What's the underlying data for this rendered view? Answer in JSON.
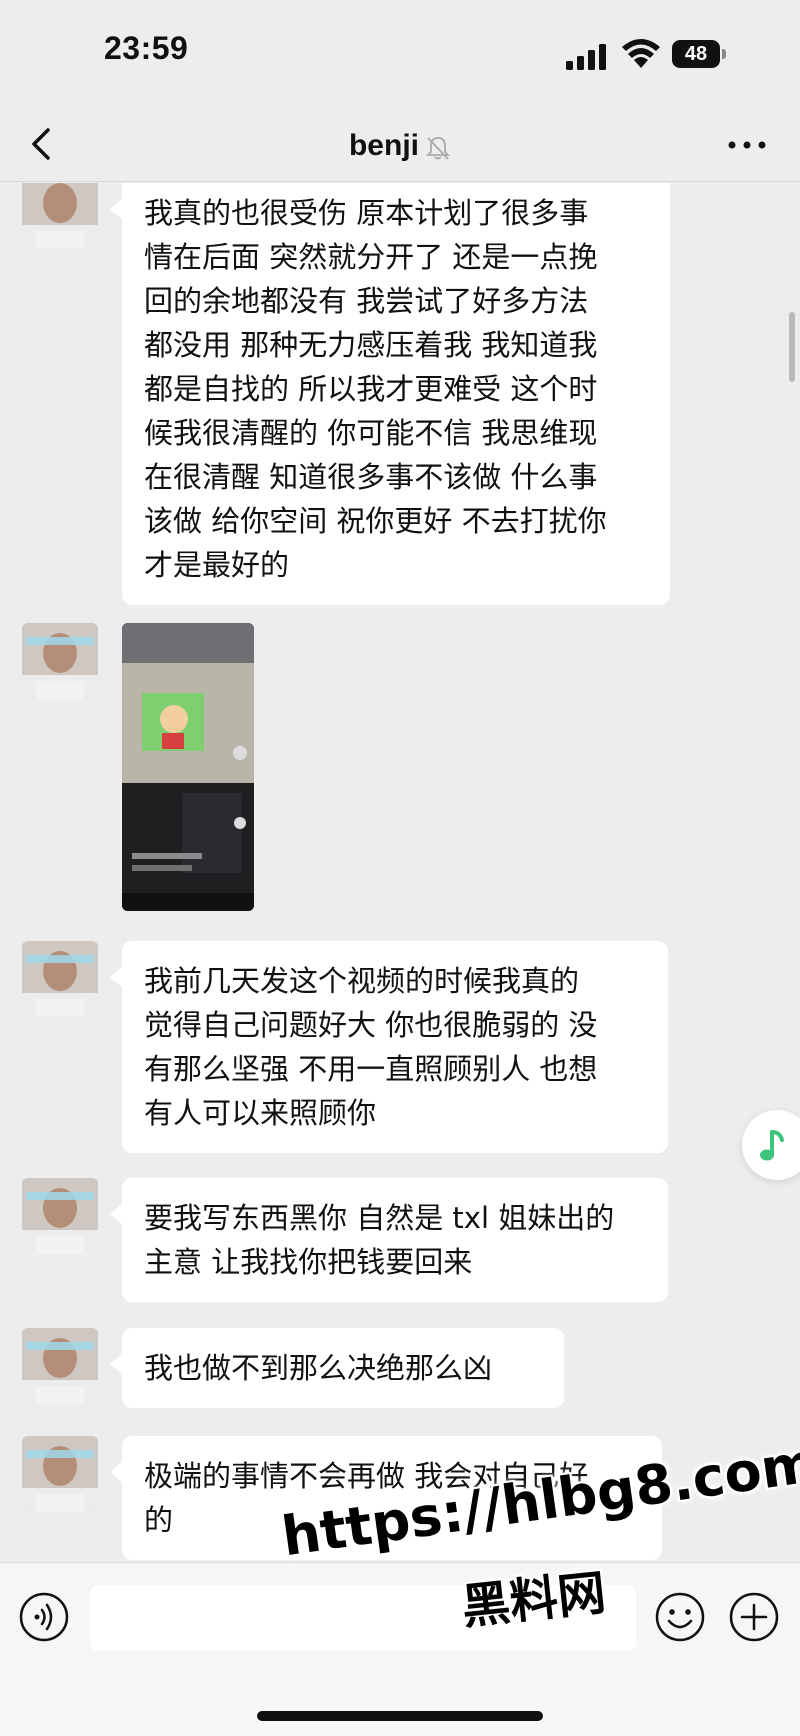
{
  "status_bar": {
    "time": "23:59",
    "battery_level": "48",
    "icons": [
      "signal-icon",
      "wifi-icon",
      "battery-icon"
    ]
  },
  "nav": {
    "title": "benji",
    "icons": [
      "back-icon",
      "mute-bell-icon",
      "more-icon"
    ]
  },
  "messages": [
    {
      "type": "text",
      "sender": "contact",
      "text": "我真的也很受伤 原本计划了很多事\n情在后面 突然就分开了 还是一点挽\n回的余地都没有 我尝试了好多方法\n都没用 那种无力感压着我 我知道我\n都是自找的 所以我才更难受 这个时\n候我很清醒的 你可能不信 我思维现\n在很清醒 知道很多事不该做 什么事\n该做 给你空间 祝你更好 不去打扰你\n才是最好的"
    },
    {
      "type": "video",
      "sender": "contact"
    },
    {
      "type": "text",
      "sender": "contact",
      "text": "我前几天发这个视频的时候我真的\n觉得自己问题好大 你也很脆弱的 没\n有那么坚强 不用一直照顾别人 也想\n有人可以来照顾你"
    },
    {
      "type": "text",
      "sender": "contact",
      "text": "要我写东西黑你 自然是 txl 姐妹出的\n主意 让我找你把钱要回来"
    },
    {
      "type": "text",
      "sender": "contact",
      "text": "我也做不到那么决绝那么凶"
    },
    {
      "type": "text",
      "sender": "contact",
      "text": "极端的事情不会再做 我会对自己好\n的"
    }
  ],
  "input_bar": {
    "placeholder": "",
    "icons": [
      "voice-icon",
      "emoji-icon",
      "plus-icon"
    ]
  },
  "watermark": {
    "url": "https://hlbg8.com",
    "site_name": "黑料网"
  },
  "colors": {
    "background": "#ededed",
    "bubble": "#ffffff",
    "music_accent": "#3cc47c"
  }
}
